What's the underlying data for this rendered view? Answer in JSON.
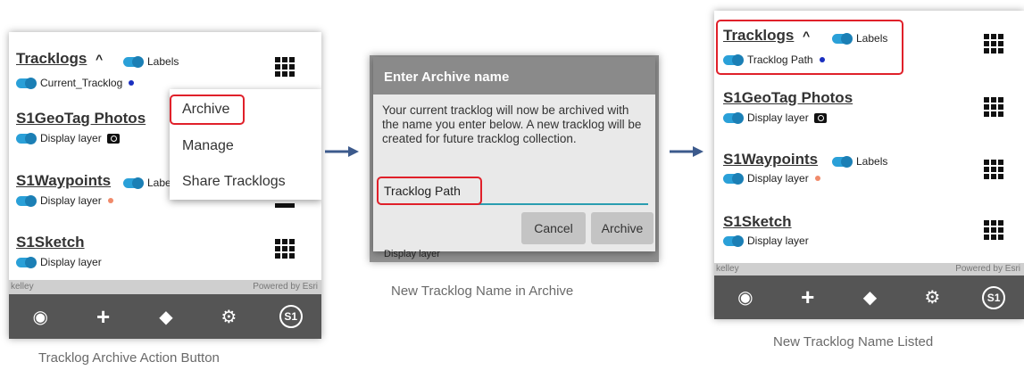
{
  "panel1": {
    "rows": [
      {
        "title": "Tracklogs",
        "caret": "^",
        "labels": "Labels",
        "sub": "Current_Tracklog"
      },
      {
        "title": "S1GeoTag Photos",
        "sub": "Display layer"
      },
      {
        "title": "S1Waypoints",
        "labels": "Labe",
        "sub": "Display layer"
      },
      {
        "title": "S1Sketch",
        "sub": "Display layer"
      }
    ],
    "menu": [
      "Archive",
      "Manage",
      "Share Tracklogs"
    ],
    "map_left": "kelley",
    "map_right": "Powered by Esri",
    "caption": "Tracklog Archive Action Button"
  },
  "panel2": {
    "dialog_title": "Enter Archive name",
    "dialog_text": "Your current tracklog will now be archived with the name you enter below. A new tracklog will be created for future tracklog collection.",
    "input_value": "Tracklog Path",
    "cancel": "Cancel",
    "archive": "Archive",
    "behind_sub": "Display layer",
    "caption": "New Tracklog Name in  Archive"
  },
  "panel3": {
    "rows": [
      {
        "title": "Tracklogs",
        "caret": "^",
        "labels": "Labels",
        "sub": "Tracklog Path"
      },
      {
        "title": "S1GeoTag Photos",
        "sub": "Display layer"
      },
      {
        "title": "S1Waypoints",
        "labels": "Labels",
        "sub": "Display layer"
      },
      {
        "title": "S1Sketch",
        "sub": "Display layer"
      }
    ],
    "map_left": "kelley",
    "map_right": "Powered by Esri",
    "caption": "New Tracklog Name Listed"
  },
  "icons": [
    "target-icon",
    "plus-icon",
    "layers-icon",
    "gear-icon",
    "s1-logo-icon",
    "grid-menu-icon",
    "camera-icon",
    "arrow-right-icon"
  ],
  "colors": {
    "toggle": "#2aa0d8",
    "highlight": "#e0202a",
    "blue_dot": "#1a2fc0",
    "orange_dot": "#f08a6a",
    "footer": "#555555",
    "arrow": "#3c5a8c"
  }
}
